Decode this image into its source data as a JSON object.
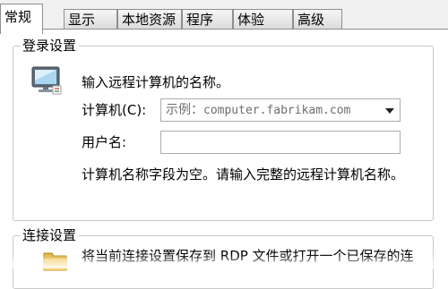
{
  "tabs": [
    {
      "label": "常规",
      "active": true
    },
    {
      "label": "显示",
      "active": false
    },
    {
      "label": "本地资源",
      "active": false
    },
    {
      "label": "程序",
      "active": false
    },
    {
      "label": "体验",
      "active": false
    },
    {
      "label": "高级",
      "active": false
    }
  ],
  "login_settings": {
    "title": "登录设置",
    "instruction": "输入远程计算机的名称。",
    "computer_label": "计算机(C):",
    "computer_placeholder_prefix": "示例：",
    "computer_placeholder_example": "computer.fabrikam.com",
    "username_label": "用户名:",
    "username_value": "",
    "warning": "计算机名称字段为空。请输入完整的远程计算机名称。",
    "icon": "computer-monitor-icon"
  },
  "connection_settings": {
    "title": "连接设置",
    "description": "将当前连接设置保存到 RDP 文件或打开一个已保存的连",
    "icon": "folder-icon"
  }
}
